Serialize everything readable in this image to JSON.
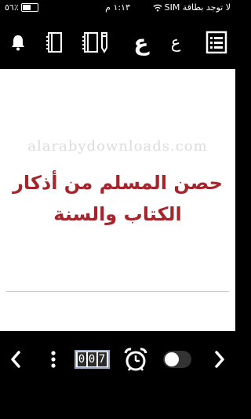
{
  "status_bar": {
    "carrier": "لا توجد بطاقة SIM",
    "time": "١:١٣ م",
    "battery": "٥٦٪"
  },
  "toolbar": {
    "font_large_letter": "ع",
    "font_small_letter": "ع"
  },
  "content": {
    "watermark": "alarabydownloads.com",
    "title_line1": "حصن المسلم من أذكار",
    "title_line2": "الكتاب والسنة"
  },
  "bottom_bar": {
    "counter_digits": [
      "0",
      "0",
      "7"
    ]
  }
}
